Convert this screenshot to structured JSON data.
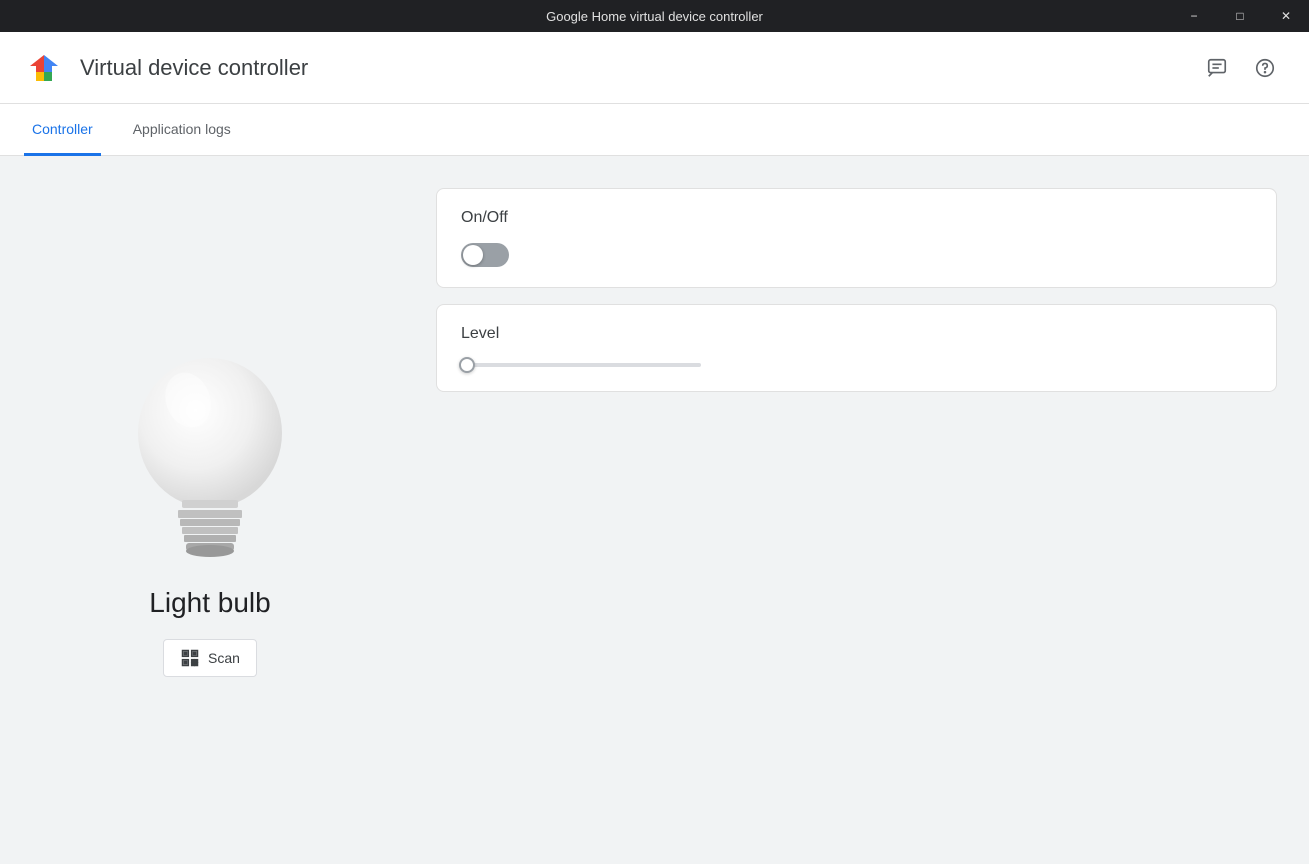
{
  "titlebar": {
    "title": "Google Home virtual device controller",
    "minimize_label": "−",
    "maximize_label": "□",
    "close_label": "✕"
  },
  "header": {
    "app_title": "Virtual device controller",
    "feedback_icon": "feedback-icon",
    "help_icon": "help-icon"
  },
  "tabs": [
    {
      "label": "Controller",
      "active": true
    },
    {
      "label": "Application logs",
      "active": false
    }
  ],
  "device": {
    "name": "Light bulb",
    "scan_button_label": "Scan"
  },
  "controls": {
    "on_off_label": "On/Off",
    "on_off_value": false,
    "level_label": "Level",
    "level_value": 0
  }
}
